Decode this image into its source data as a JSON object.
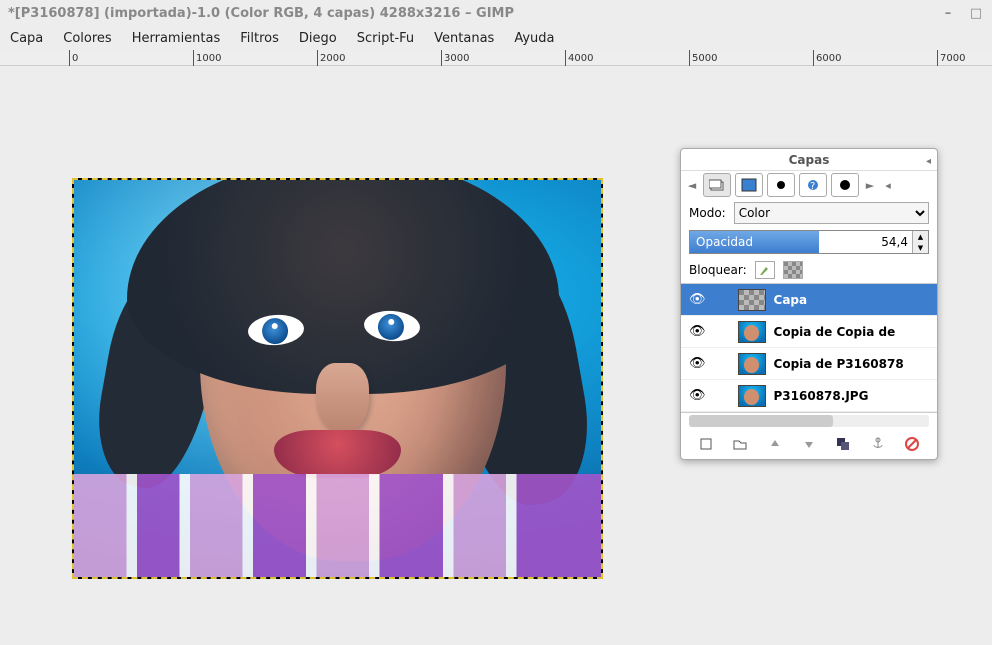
{
  "window": {
    "title": "*[P3160878] (importada)-1.0 (Color RGB, 4 capas) 4288x3216 – GIMP"
  },
  "menu": {
    "items": [
      "Capa",
      "Colores",
      "Herramientas",
      "Filtros",
      "Diego",
      "Script-Fu",
      "Ventanas",
      "Ayuda"
    ]
  },
  "ruler": {
    "ticks": [
      {
        "pos": 69,
        "label": "0"
      },
      {
        "pos": 193,
        "label": "1000"
      },
      {
        "pos": 317,
        "label": "2000"
      },
      {
        "pos": 441,
        "label": "3000"
      },
      {
        "pos": 565,
        "label": "4000"
      },
      {
        "pos": 689,
        "label": "5000"
      },
      {
        "pos": 813,
        "label": "6000"
      },
      {
        "pos": 937,
        "label": "7000"
      }
    ]
  },
  "layers_panel": {
    "title": "Capas",
    "mode_label": "Modo:",
    "mode_value": "Color",
    "opacity_label": "Opacidad",
    "opacity_value": "54,4",
    "opacity_percent": 54.4,
    "lock_label": "Bloquear:",
    "layers": [
      {
        "visible": true,
        "name": "Capa",
        "thumb": "transp",
        "selected": true
      },
      {
        "visible": true,
        "name": "Copia de Copia de",
        "thumb": "photo",
        "selected": false
      },
      {
        "visible": true,
        "name": "Copia de P3160878",
        "thumb": "photo",
        "selected": false
      },
      {
        "visible": true,
        "name": "P3160878.JPG",
        "thumb": "photo",
        "selected": false
      }
    ]
  }
}
